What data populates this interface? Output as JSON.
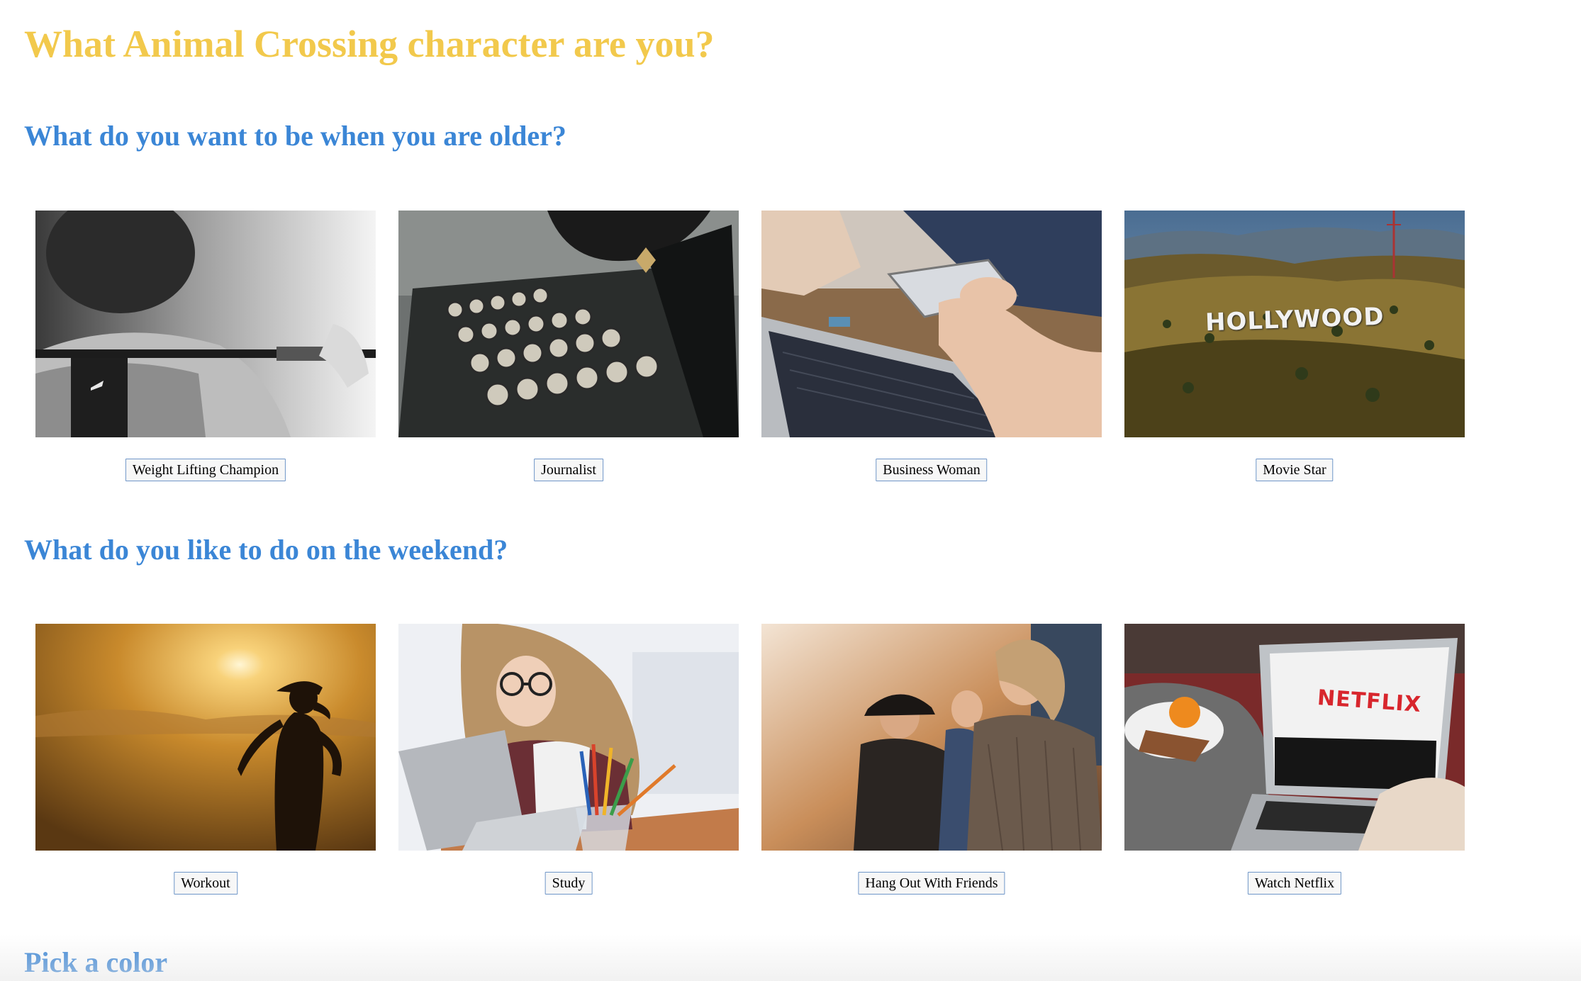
{
  "page_title": "What Animal Crossing character are you?",
  "colors": {
    "title": "#f2c94c",
    "question": "#3b86d6",
    "button_border": "#6f96c8"
  },
  "questions": [
    {
      "title": "What do you want to be when you are older?",
      "answers": [
        {
          "label": "Weight Lifting Champion",
          "image": "barbell-athlete-photo"
        },
        {
          "label": "Journalist",
          "image": "typewriter-photo"
        },
        {
          "label": "Business Woman",
          "image": "laptop-phone-photo"
        },
        {
          "label": "Movie Star",
          "image": "hollywood-sign-photo",
          "sign_text": "HOLLYWOOD"
        }
      ]
    },
    {
      "title": "What do you like to do on the weekend?",
      "answers": [
        {
          "label": "Workout",
          "image": "sunset-runner-photo"
        },
        {
          "label": "Study",
          "image": "student-laptop-photo"
        },
        {
          "label": "Hang Out With Friends",
          "image": "friends-laughing-photo"
        },
        {
          "label": "Watch Netflix",
          "image": "netflix-laptop-photo",
          "screen_text": "NETFLIX"
        }
      ]
    },
    {
      "title": "Pick a color"
    }
  ]
}
